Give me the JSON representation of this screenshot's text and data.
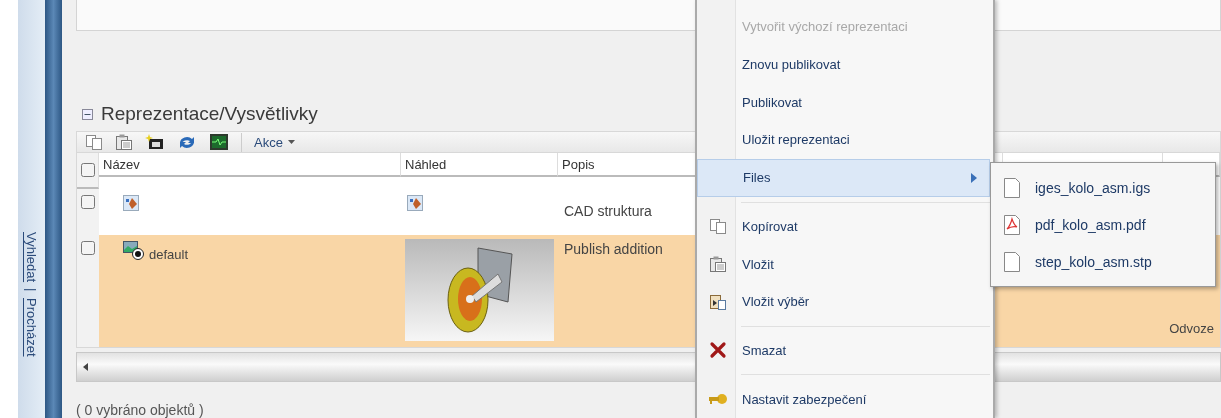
{
  "sidebar": {
    "links": [
      "Vyhledat",
      "Procházet"
    ],
    "separator": "|"
  },
  "section": {
    "title": "Reprezentace/Vysvětlivky",
    "expanded": true
  },
  "toolbar": {
    "actions_label": "Akce"
  },
  "table": {
    "header_checked": false,
    "columns": [
      "Název",
      "Náhled",
      "Popis"
    ],
    "rows": [
      {
        "kind": "structure",
        "name": "",
        "description": "CAD struktura",
        "column_5": "",
        "checked": false,
        "selected": false
      },
      {
        "kind": "representation",
        "name": "default",
        "description": "Publish addition",
        "column_5": "Odvoze",
        "checked": false,
        "selected": true
      }
    ]
  },
  "status": "( 0 vybráno objektů )",
  "context_menu": {
    "items": [
      {
        "kind": "item",
        "label": "Vytvořit výchozí reprezentaci",
        "disabled": true,
        "selected": false
      },
      {
        "kind": "item",
        "label": "Znovu publikovat",
        "disabled": false,
        "selected": false
      },
      {
        "kind": "item",
        "label": "Publikovat",
        "disabled": false,
        "selected": false
      },
      {
        "kind": "item",
        "label": "Uložit reprezentaci",
        "disabled": false,
        "selected": false
      },
      {
        "kind": "submenu",
        "label": "Files",
        "disabled": false,
        "selected": true
      },
      {
        "kind": "separator"
      },
      {
        "kind": "item",
        "label": "Kopírovat",
        "disabled": false,
        "selected": false
      },
      {
        "kind": "item",
        "label": "Vložit",
        "disabled": false,
        "selected": false
      },
      {
        "kind": "item",
        "label": "Vložit výběr",
        "disabled": false,
        "selected": false
      },
      {
        "kind": "separator"
      },
      {
        "kind": "item",
        "label": "Smazat",
        "disabled": false,
        "selected": false
      },
      {
        "kind": "separator"
      },
      {
        "kind": "item",
        "label": "Nastavit zabezpečení",
        "disabled": false,
        "selected": false
      }
    ]
  },
  "submenu": {
    "items": [
      {
        "kind": "file",
        "label": "iges_kolo_asm.igs"
      },
      {
        "kind": "pdf",
        "label": "pdf_kolo_asm.pdf"
      },
      {
        "kind": "file",
        "label": "step_kolo_asm.stp"
      }
    ]
  }
}
